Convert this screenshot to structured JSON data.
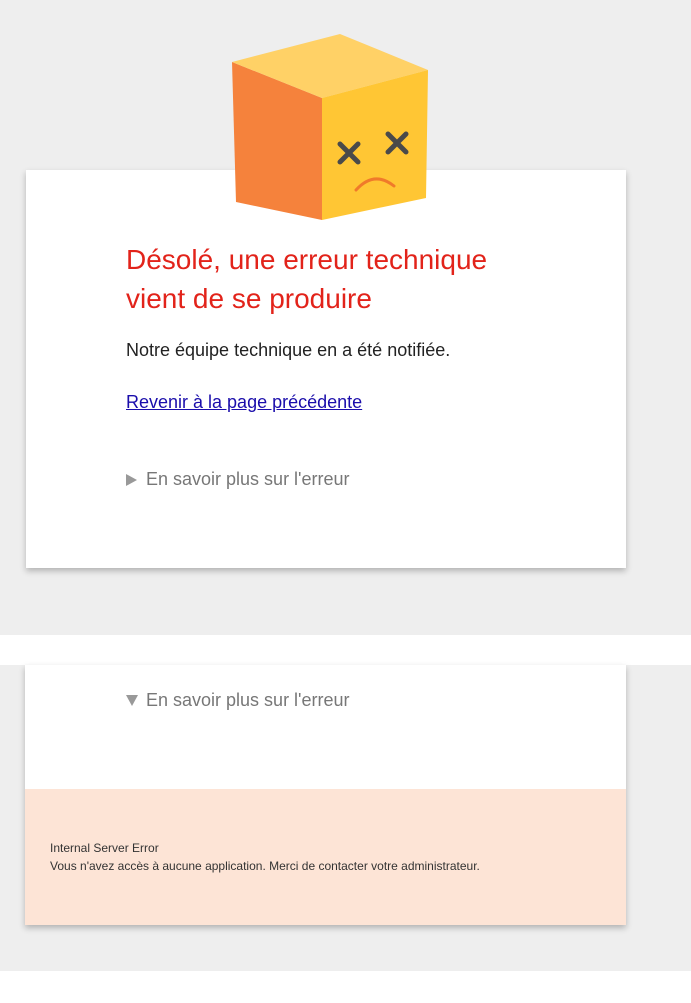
{
  "page": {
    "background": "#eeeeee",
    "title_color": "#e2231a",
    "error_box_color": "#fde4d6"
  },
  "illustration": {
    "icon": "sad-cube-icon"
  },
  "error": {
    "title_line1": "Désolé, une erreur technique",
    "title_line2": "vient de se produire",
    "subtitle": "Notre équipe technique en a été notifiée.",
    "back_link": "Revenir à la page précédente",
    "details_toggle_label": "En savoir plus sur l'erreur"
  },
  "details": {
    "toggle_label": "En savoir plus sur l'erreur",
    "error_title": "Internal Server Error",
    "error_message": "Vous n'avez accès à aucune application. Merci de contacter votre administrateur."
  }
}
